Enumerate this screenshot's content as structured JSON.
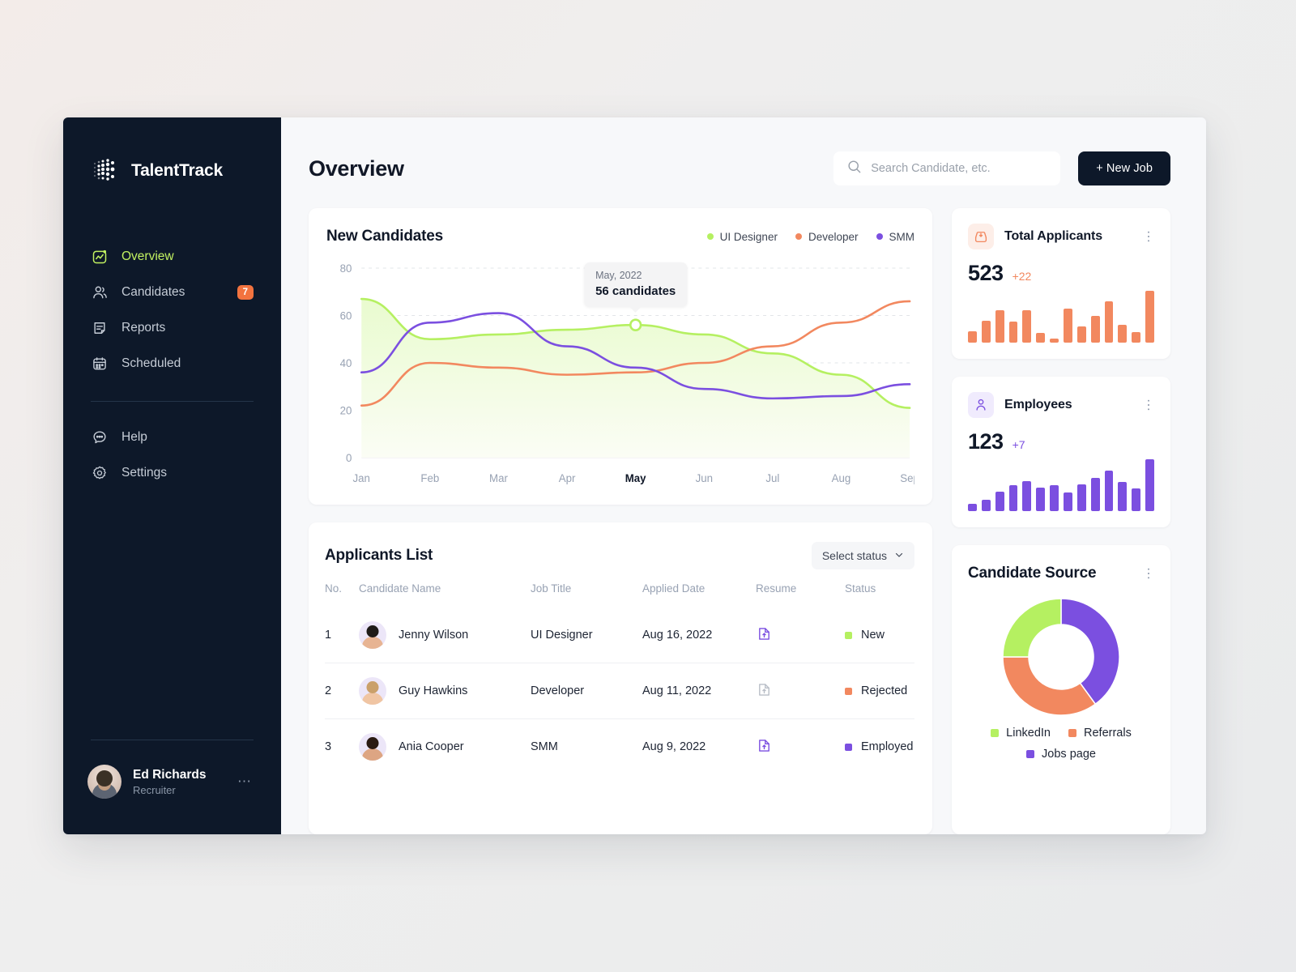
{
  "brand": {
    "name": "TalentTrack",
    "logo_icon": "dot-matrix-logo"
  },
  "sidebar": {
    "nav": [
      {
        "label": "Overview",
        "icon": "chart-square-icon",
        "active": true,
        "badge": ""
      },
      {
        "label": "Candidates",
        "icon": "users-icon",
        "active": false,
        "badge": "7"
      },
      {
        "label": "Reports",
        "icon": "document-icon",
        "active": false,
        "badge": ""
      },
      {
        "label": "Scheduled",
        "icon": "calendar-icon",
        "active": false,
        "badge": ""
      }
    ],
    "secondary": [
      {
        "label": "Help",
        "icon": "chat-bubble-icon"
      },
      {
        "label": "Settings",
        "icon": "gear-icon"
      }
    ],
    "user": {
      "name": "Ed Richards",
      "role": "Recruiter",
      "menu_icon": "ellipsis-icon"
    }
  },
  "header": {
    "title": "Overview",
    "search_placeholder": "Search Candidate, etc.",
    "search_value": "",
    "search_icon": "search-icon",
    "new_job_label": "+ New Job"
  },
  "colors": {
    "ui_designer": "#b5f061",
    "developer": "#f2885f",
    "smm": "#7b4fe0",
    "accent_dark": "#0d1829",
    "badge_orange": "#f2733f"
  },
  "chart_data": {
    "type": "line",
    "title": "New Candidates",
    "xlabel": "",
    "ylabel": "",
    "x": [
      "Jan",
      "Feb",
      "Mar",
      "Apr",
      "May",
      "Jun",
      "Jul",
      "Aug",
      "Sep"
    ],
    "highlighted_x": "May",
    "ylim": [
      0,
      80
    ],
    "yticks": [
      0,
      20,
      40,
      60,
      80
    ],
    "grid": true,
    "legend_position": "top-right",
    "series": [
      {
        "name": "UI Designer",
        "color": "#b5f061",
        "values": [
          67,
          50,
          52,
          54,
          56,
          52,
          44,
          35,
          21
        ]
      },
      {
        "name": "Developer",
        "color": "#f2885f",
        "values": [
          22,
          40,
          38,
          35,
          36,
          40,
          47,
          57,
          66
        ]
      },
      {
        "name": "SMM",
        "color": "#7b4fe0",
        "values": [
          36,
          57,
          61,
          47,
          38,
          29,
          25,
          26,
          31
        ]
      }
    ],
    "tooltip": {
      "label": "May, 2022",
      "value": "56 candidates"
    }
  },
  "stats": [
    {
      "name": "Total Applicants",
      "icon": "inbox-download-icon",
      "value": "523",
      "delta": "+22",
      "color": "#f2885f",
      "icon_bg": "#fdeee8",
      "menu_icon": "kebab-menu-icon",
      "spark": [
        22,
        42,
        62,
        40,
        62,
        18,
        8,
        66,
        32,
        52,
        80,
        34,
        20,
        100
      ]
    },
    {
      "name": "Employees",
      "icon": "user-icon",
      "value": "123",
      "delta": "+7",
      "color": "#7b4fe0",
      "icon_bg": "#f0ebfd",
      "menu_icon": "kebab-menu-icon",
      "spark": [
        14,
        22,
        38,
        50,
        58,
        46,
        50,
        36,
        52,
        64,
        78,
        56,
        44,
        100
      ]
    }
  ],
  "applicants": {
    "title": "Applicants List",
    "filter_label": "Select status",
    "filter_icon": "chevron-down-icon",
    "columns": [
      "No.",
      "Candidate Name",
      "Job Title",
      "Applied Date",
      "Resume",
      "Status"
    ],
    "rows": [
      {
        "no": "1",
        "name": "Jenny Wilson",
        "job": "UI Designer",
        "date": "Aug 16, 2022",
        "resume_icon": "file-upload-icon",
        "resume_active": true,
        "status": "New",
        "status_color": "#b5f061",
        "avatar": {
          "hair": "#1e1b18",
          "skin": "#e7b493"
        }
      },
      {
        "no": "2",
        "name": "Guy Hawkins",
        "job": "Developer",
        "date": "Aug 11, 2022",
        "resume_icon": "file-upload-icon",
        "resume_active": false,
        "status": "Rejected",
        "status_color": "#f2885f",
        "avatar": {
          "hair": "#caa06a",
          "skin": "#f0c5a3"
        }
      },
      {
        "no": "3",
        "name": "Ania Cooper",
        "job": "SMM",
        "date": "Aug 9, 2022",
        "resume_icon": "file-upload-icon",
        "resume_active": true,
        "status": "Employed",
        "status_color": "#7b4fe0",
        "avatar": {
          "hair": "#2a1a12",
          "skin": "#dda583"
        }
      }
    ]
  },
  "candidate_source": {
    "title": "Candidate Source",
    "menu_icon": "kebab-menu-icon",
    "chart_data": {
      "type": "pie",
      "title": "Candidate Source",
      "labels": [
        "Jobs page",
        "Referrals",
        "LinkedIn"
      ],
      "values": [
        40,
        35,
        25
      ],
      "colors": [
        "#7b4fe0",
        "#f2885f",
        "#b5f061"
      ],
      "legend_position": "bottom",
      "donut": true
    },
    "legend": [
      {
        "label": "LinkedIn",
        "color": "#b5f061"
      },
      {
        "label": "Referrals",
        "color": "#f2885f"
      },
      {
        "label": "Jobs page",
        "color": "#7b4fe0"
      }
    ]
  }
}
